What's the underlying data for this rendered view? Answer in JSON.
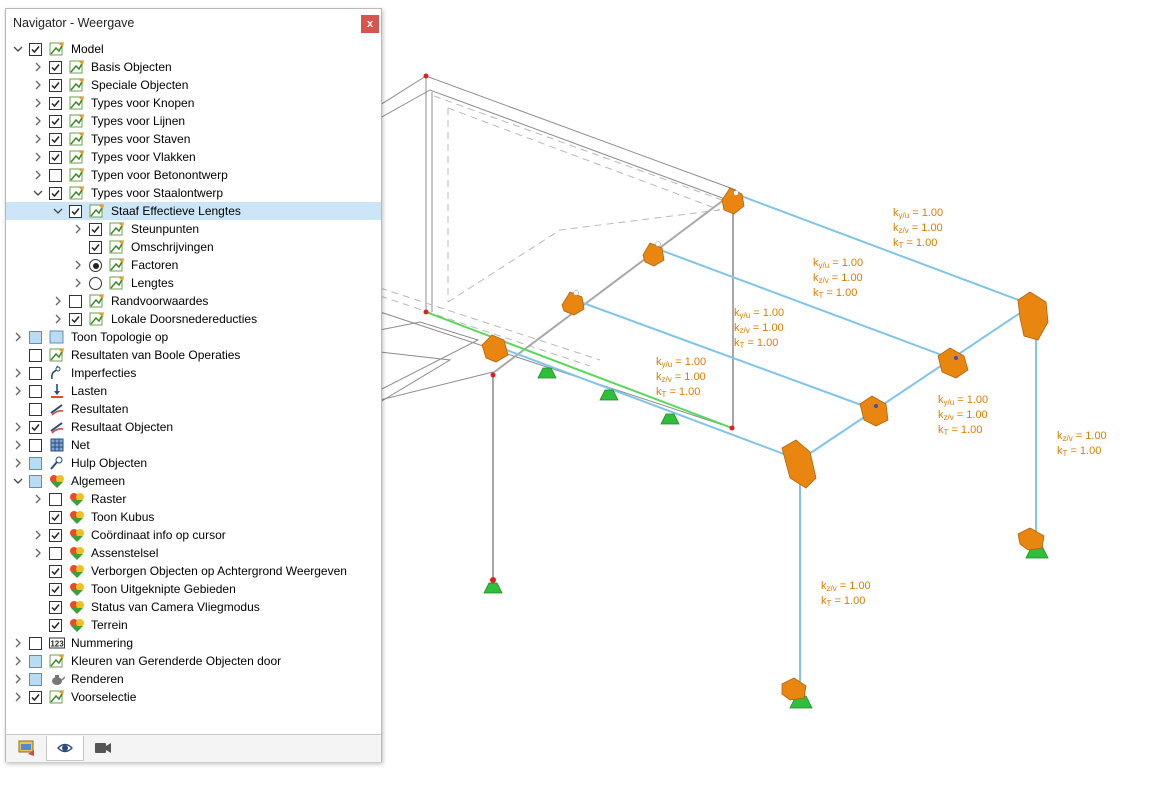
{
  "navigator": {
    "title": "Navigator - Weergave",
    "close_label": "x",
    "items": [
      {
        "label": "Model",
        "level": 0,
        "expander": "down",
        "check": "checked",
        "icon": "model-icon"
      },
      {
        "label": "Basis Objecten",
        "level": 1,
        "expander": "right",
        "check": "checked",
        "icon": "model-icon"
      },
      {
        "label": "Speciale Objecten",
        "level": 1,
        "expander": "right",
        "check": "checked",
        "icon": "model-icon"
      },
      {
        "label": "Types voor Knopen",
        "level": 1,
        "expander": "right",
        "check": "checked",
        "icon": "model-icon"
      },
      {
        "label": "Types voor Lijnen",
        "level": 1,
        "expander": "right",
        "check": "checked",
        "icon": "model-icon"
      },
      {
        "label": "Types voor Staven",
        "level": 1,
        "expander": "right",
        "check": "checked",
        "icon": "model-icon"
      },
      {
        "label": "Types voor Vlakken",
        "level": 1,
        "expander": "right",
        "check": "checked",
        "icon": "model-icon"
      },
      {
        "label": "Typen voor Betonontwerp",
        "level": 1,
        "expander": "right",
        "check": "unchecked",
        "icon": "model-icon"
      },
      {
        "label": "Types voor Staalontwerp",
        "level": 1,
        "expander": "down",
        "check": "checked",
        "icon": "model-icon"
      },
      {
        "label": "Staaf Effectieve Lengtes",
        "level": 2,
        "expander": "down",
        "check": "checked",
        "icon": "model-icon",
        "selected": true
      },
      {
        "label": "Steunpunten",
        "level": 3,
        "expander": "right",
        "check": "checked",
        "icon": "model-icon"
      },
      {
        "label": "Omschrijvingen",
        "level": 3,
        "expander": "none",
        "check": "checked",
        "icon": "model-icon"
      },
      {
        "label": "Factoren",
        "level": 3,
        "expander": "right",
        "check": "radio-on",
        "icon": "model-icon"
      },
      {
        "label": "Lengtes",
        "level": 3,
        "expander": "right",
        "check": "radio-off",
        "icon": "model-icon"
      },
      {
        "label": "Randvoorwaardes",
        "level": 2,
        "expander": "right",
        "check": "unchecked",
        "icon": "model-icon"
      },
      {
        "label": "Lokale Doorsnedereducties",
        "level": 2,
        "expander": "right",
        "check": "checked",
        "icon": "model-icon"
      },
      {
        "label": "Toon Topologie op",
        "level": 0,
        "expander": "right",
        "check": "partial",
        "icon": "topology-icon"
      },
      {
        "label": "Resultaten van Boole Operaties",
        "level": 0,
        "expander": "none",
        "check": "unchecked",
        "icon": "model-icon"
      },
      {
        "label": "Imperfecties",
        "level": 0,
        "expander": "right",
        "check": "unchecked",
        "icon": "imperfection-icon"
      },
      {
        "label": "Lasten",
        "level": 0,
        "expander": "right",
        "check": "unchecked",
        "icon": "load-icon"
      },
      {
        "label": "Resultaten",
        "level": 0,
        "expander": "none",
        "check": "unchecked",
        "icon": "result-icon"
      },
      {
        "label": "Resultaat Objecten",
        "level": 0,
        "expander": "right",
        "check": "checked",
        "icon": "result-icon"
      },
      {
        "label": "Net",
        "level": 0,
        "expander": "right",
        "check": "unchecked",
        "icon": "mesh-icon"
      },
      {
        "label": "Hulp Objecten",
        "level": 0,
        "expander": "right",
        "check": "partial",
        "icon": "helper-icon"
      },
      {
        "label": "Algemeen",
        "level": 0,
        "expander": "down",
        "check": "partial",
        "icon": "general-icon"
      },
      {
        "label": "Raster",
        "level": 1,
        "expander": "right",
        "check": "unchecked",
        "icon": "general-icon"
      },
      {
        "label": "Toon Kubus",
        "level": 1,
        "expander": "none",
        "check": "checked",
        "icon": "general-icon"
      },
      {
        "label": "Coördinaat info op cursor",
        "level": 1,
        "expander": "right",
        "check": "checked",
        "icon": "general-icon"
      },
      {
        "label": "Assenstelsel",
        "level": 1,
        "expander": "right",
        "check": "unchecked",
        "icon": "general-icon"
      },
      {
        "label": "Verborgen Objecten op Achtergrond Weergeven",
        "level": 1,
        "expander": "none",
        "check": "checked",
        "icon": "general-icon"
      },
      {
        "label": "Toon Uitgeknipte Gebieden",
        "level": 1,
        "expander": "none",
        "check": "checked",
        "icon": "general-icon"
      },
      {
        "label": "Status van Camera Vliegmodus",
        "level": 1,
        "expander": "none",
        "check": "checked",
        "icon": "general-icon"
      },
      {
        "label": "Terrein",
        "level": 1,
        "expander": "none",
        "check": "checked",
        "icon": "general-icon"
      },
      {
        "label": "Nummering",
        "level": 0,
        "expander": "right",
        "check": "unchecked",
        "icon": "numbering-icon"
      },
      {
        "label": "Kleuren van Gerenderde Objecten door",
        "level": 0,
        "expander": "right",
        "check": "partial",
        "icon": "model-icon"
      },
      {
        "label": "Renderen",
        "level": 0,
        "expander": "right",
        "check": "partial",
        "icon": "teapot-icon"
      },
      {
        "label": "Voorselectie",
        "level": 0,
        "expander": "right",
        "check": "checked",
        "icon": "model-icon"
      }
    ],
    "numbering_icon_text": "123",
    "tabs": [
      {
        "name": "data-tab",
        "icon": "data-icon",
        "active": false
      },
      {
        "name": "display-tab",
        "icon": "eye-icon",
        "active": true
      },
      {
        "name": "views-tab",
        "icon": "camera-icon",
        "active": false
      }
    ]
  },
  "viewport": {
    "colors": {
      "member": "#7fc4ea",
      "label": "#e07b00",
      "support": "#2fbf3a",
      "hinge": "#e8860f",
      "gray": "#9a9a9a"
    },
    "annotations": [
      {
        "lines": [
          [
            "k",
            "y/u",
            " = 1.00"
          ],
          [
            "k",
            "z/v",
            " = 1.00"
          ],
          [
            "k",
            "T",
            " = 1.00"
          ]
        ]
      },
      {
        "lines": [
          [
            "k",
            "y/u",
            " = 1.00"
          ],
          [
            "k",
            "z/v",
            " = 1.00"
          ],
          [
            "k",
            "T",
            " = 1.00"
          ]
        ]
      },
      {
        "lines": [
          [
            "k",
            "y/u",
            " = 1.00"
          ],
          [
            "k",
            "z/v",
            " = 1.00"
          ],
          [
            "k",
            "T",
            " = 1.00"
          ]
        ]
      },
      {
        "lines": [
          [
            "k",
            "y/u",
            " = 1.00"
          ],
          [
            "k",
            "z/v",
            " = 1.00"
          ],
          [
            "k",
            "T",
            " = 1.00"
          ]
        ]
      },
      {
        "lines": [
          [
            "k",
            "y/u",
            " = 1.00"
          ],
          [
            "k",
            "z/v",
            " = 1.00"
          ],
          [
            "k",
            "T",
            " = 1.00"
          ]
        ]
      },
      {
        "lines": [
          [
            "k",
            "z/v",
            " = 1.00"
          ],
          [
            "k",
            "T",
            " = 1.00"
          ]
        ]
      },
      {
        "lines": [
          [
            "k",
            "z/v",
            " = 1.00"
          ],
          [
            "k",
            "T",
            " = 1.00"
          ]
        ]
      }
    ]
  }
}
